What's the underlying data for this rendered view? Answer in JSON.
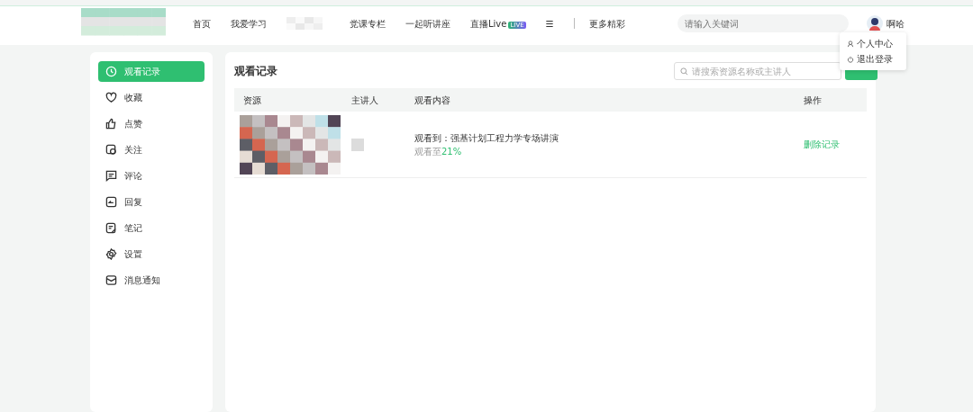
{
  "nav": {
    "items": [
      {
        "label": "首页",
        "kind": "link"
      },
      {
        "label": "我爱学习",
        "kind": "link"
      },
      {
        "kind": "blurred"
      },
      {
        "label": "党课专栏",
        "kind": "link"
      },
      {
        "label": "一起听讲座",
        "kind": "link"
      },
      {
        "label": "直播Live",
        "badge": "LIVE",
        "kind": "link"
      },
      {
        "label": "☰",
        "kind": "link"
      },
      {
        "label": "更多精彩",
        "kind": "link"
      }
    ],
    "search": {
      "placeholder": "请输入关键词"
    },
    "user": {
      "name": "啊哈"
    },
    "menu": [
      {
        "label": "个人中心"
      },
      {
        "label": "退出登录"
      }
    ]
  },
  "sidebar": {
    "items": [
      {
        "label": "观看记录",
        "selected": true
      },
      {
        "label": "收藏",
        "selected": false
      },
      {
        "label": "点赞",
        "selected": false
      },
      {
        "label": "关注",
        "selected": false
      },
      {
        "label": "评论",
        "selected": false
      },
      {
        "label": "回复",
        "selected": false
      },
      {
        "label": "笔记",
        "selected": false
      },
      {
        "label": "设置",
        "selected": false
      },
      {
        "label": "消息通知",
        "selected": false
      }
    ]
  },
  "main": {
    "title": "观看记录",
    "search": {
      "placeholder": "请搜索资源名称或主讲人"
    },
    "table": {
      "columns": [
        "资源",
        "主讲人",
        "观看内容",
        "操作"
      ],
      "rows": [
        {
          "content": "观看到：强基计划工程力学专场讲演",
          "progress_label": "观看至",
          "progress": "21%",
          "action": "删除记录"
        }
      ]
    }
  }
}
